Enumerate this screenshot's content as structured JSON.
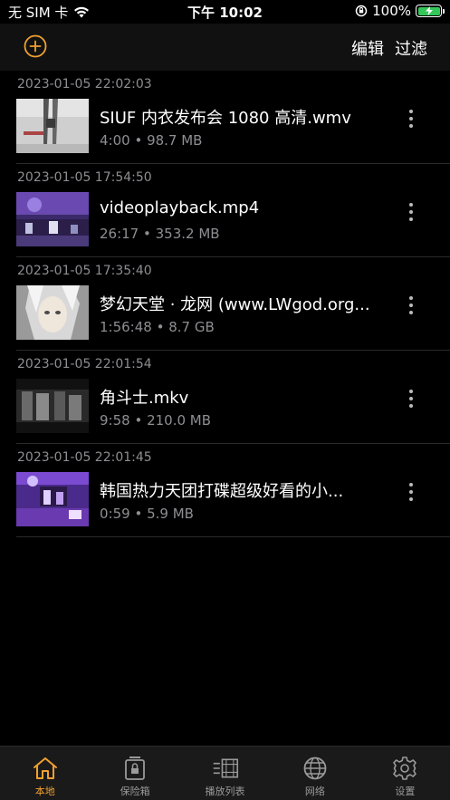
{
  "status_bar": {
    "carrier": "无 SIM 卡",
    "time": "下午 10:02",
    "battery_percent": "100%",
    "battery_level": 1.0
  },
  "nav": {
    "add_icon": "plus-circle-icon",
    "edit_label": "编辑",
    "filter_label": "过滤"
  },
  "items": [
    {
      "date": "2023-01-05 22:02:03",
      "title": "SIUF 内衣发布会 1080 高清.wmv",
      "meta": "4:00 • 98.7 MB"
    },
    {
      "date": "2023-01-05 17:54:50",
      "title": "videoplayback.mp4",
      "meta": "26:17 • 353.2 MB"
    },
    {
      "date": "2023-01-05 17:35:40",
      "title": "梦幻天堂 · 龙网 (www.LWgod.org...",
      "meta": "1:56:48 • 8.7 GB"
    },
    {
      "date": "2023-01-05 22:01:54",
      "title": "角斗士.mkv",
      "meta": "9:58 • 210.0 MB"
    },
    {
      "date": "2023-01-05 22:01:45",
      "title": "韩国热力天团打碟超级好看的小...",
      "meta": "0:59 • 5.9 MB"
    }
  ],
  "tabs": [
    {
      "label": "本地",
      "icon": "home-icon",
      "active": true
    },
    {
      "label": "保险箱",
      "icon": "vault-icon",
      "active": false
    },
    {
      "label": "播放列表",
      "icon": "playlist-icon",
      "active": false
    },
    {
      "label": "网络",
      "icon": "globe-icon",
      "active": false
    },
    {
      "label": "设置",
      "icon": "gear-icon",
      "active": false
    }
  ],
  "colors": {
    "accent": "#f0a030",
    "battery": "#34c759",
    "secondary_text": "#8e8e93"
  }
}
